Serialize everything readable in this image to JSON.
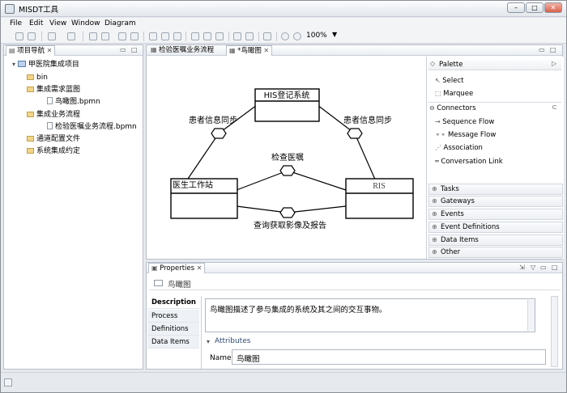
{
  "window": {
    "title": "MISDT工具",
    "controls": {
      "minimize": "–",
      "maximize": "□",
      "close": "✕"
    }
  },
  "menubar": [
    "File",
    "Edit",
    "View",
    "Window",
    "Diagram"
  ],
  "toolbar": {
    "zoom": "100%"
  },
  "navigator": {
    "title": "项目导航",
    "tree": [
      {
        "label": "甲医院集成项目",
        "level": 0,
        "type": "project"
      },
      {
        "label": "bin",
        "level": 1,
        "type": "folder"
      },
      {
        "label": "集成需求蓝图",
        "level": 1,
        "type": "folder"
      },
      {
        "label": "鸟瞰图.bpmn",
        "level": 2,
        "type": "file"
      },
      {
        "label": "集成业务流程",
        "level": 1,
        "type": "folder"
      },
      {
        "label": "检验医嘱业务流程.bpmn",
        "level": 2,
        "type": "file"
      },
      {
        "label": "通道配置文件",
        "level": 1,
        "type": "folder"
      },
      {
        "label": "系统集成约定",
        "level": 1,
        "type": "folder"
      }
    ]
  },
  "editor": {
    "tabs": [
      {
        "label": "检验医嘱业务流程",
        "active": false
      },
      {
        "label": "*鸟瞰图",
        "active": true
      }
    ],
    "diagram": {
      "his": "HIS登记系统",
      "doctor": "医生工作站",
      "ris": "RIS",
      "edge_left": "患者信息同步",
      "edge_right": "患者信息同步",
      "edge_top": "检查医嘱",
      "edge_bottom": "查询获取影像及报告"
    }
  },
  "palette": {
    "title": "Palette",
    "tools": [
      {
        "label": "Select",
        "icon": "arrow-cursor-icon"
      },
      {
        "label": "Marquee",
        "icon": "marquee-icon"
      }
    ],
    "connectors_title": "Connectors",
    "connectors": [
      {
        "label": "Sequence Flow"
      },
      {
        "label": "Message Flow"
      },
      {
        "label": "Association"
      },
      {
        "label": "Conversation Link"
      }
    ],
    "drawers": [
      "Tasks",
      "Gateways",
      "Events",
      "Event Definitions",
      "Data Items",
      "Other"
    ]
  },
  "properties": {
    "title": "Properties",
    "header": "鸟瞰图",
    "tabs": [
      "Description",
      "Process",
      "Definitions",
      "Data Items"
    ],
    "description": "鸟瞰图描述了参与集成的系统及其之间的交互事物。",
    "attributes_title": "Attributes",
    "name_label": "Name",
    "name_value": "鸟瞰图"
  }
}
